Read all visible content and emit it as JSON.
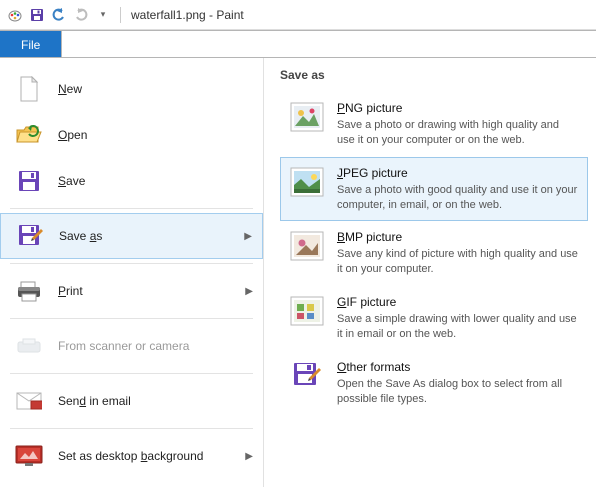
{
  "window": {
    "title": "waterfall1.png - Paint"
  },
  "fileTab": "File",
  "leftMenu": {
    "new": "New",
    "open": "Open",
    "save": "Save",
    "saveAs": "Save as",
    "print": "Print",
    "scanner": "From scanner or camera",
    "sendEmail": "Send in email",
    "desktopBg": "Set as desktop background"
  },
  "saveAsPanel": {
    "header": "Save as",
    "png": {
      "title": "PNG picture",
      "desc": "Save a photo or drawing with high quality and use it on your computer or on the web."
    },
    "jpeg": {
      "title": "JPEG picture",
      "desc": "Save a photo with good quality and use it on your computer, in email, or on the web."
    },
    "bmp": {
      "title": "BMP picture",
      "desc": "Save any kind of picture with high quality and use it on your computer."
    },
    "gif": {
      "title": "GIF picture",
      "desc": "Save a simple drawing with lower quality and use it in email or on the web."
    },
    "other": {
      "title": "Other formats",
      "desc": "Open the Save As dialog box to select from all possible file types."
    }
  }
}
